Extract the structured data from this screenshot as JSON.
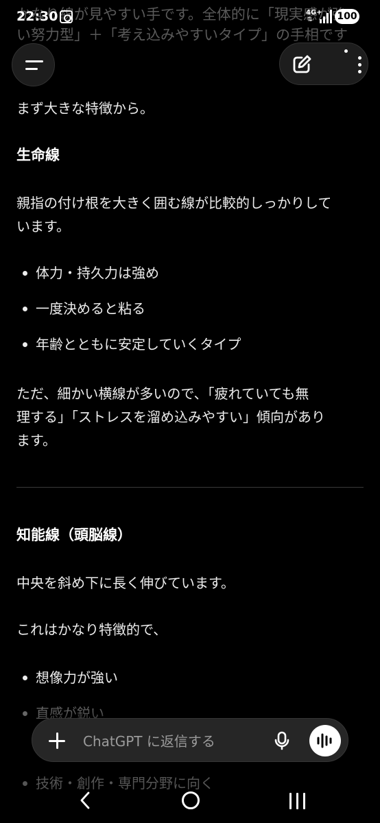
{
  "status_bar": {
    "time": "22:30",
    "network": "4G+",
    "battery": "100"
  },
  "top_faded": {
    "line1": "かなり線が見やすい手です。全体的に「現実感が強",
    "line2": "い努力型」＋「考え込みやすいタイプ」の手相です"
  },
  "message": {
    "intro": "まず大きな特徴から。",
    "section1": {
      "heading": "生命線",
      "para_line1": "親指の付け根を大きく囲む線が比較的しっかりして",
      "para_line2": "います。",
      "bullets": [
        "体力・持久力は強め",
        "一度決めると粘る",
        "年齢とともに安定していくタイプ"
      ],
      "note_line1": "ただ、細かい横線が多いので、「疲れていても無",
      "note_line2": "理する」「ストレスを溜め込みやすい」傾向があり",
      "note_line3": "ます。"
    },
    "section2": {
      "heading": "知能線（頭脳線）",
      "para": "中央を斜め下に長く伸びています。",
      "para2": "これはかなり特徴的で、",
      "bullets": [
        "想像力が強い",
        "直感が鋭い",
        "技術・創作・専門分野に向く"
      ]
    }
  },
  "composer": {
    "placeholder": "ChatGPT に返信する"
  },
  "colors": {
    "background": "#000000",
    "text": "#ececec",
    "composer": "#262626"
  }
}
